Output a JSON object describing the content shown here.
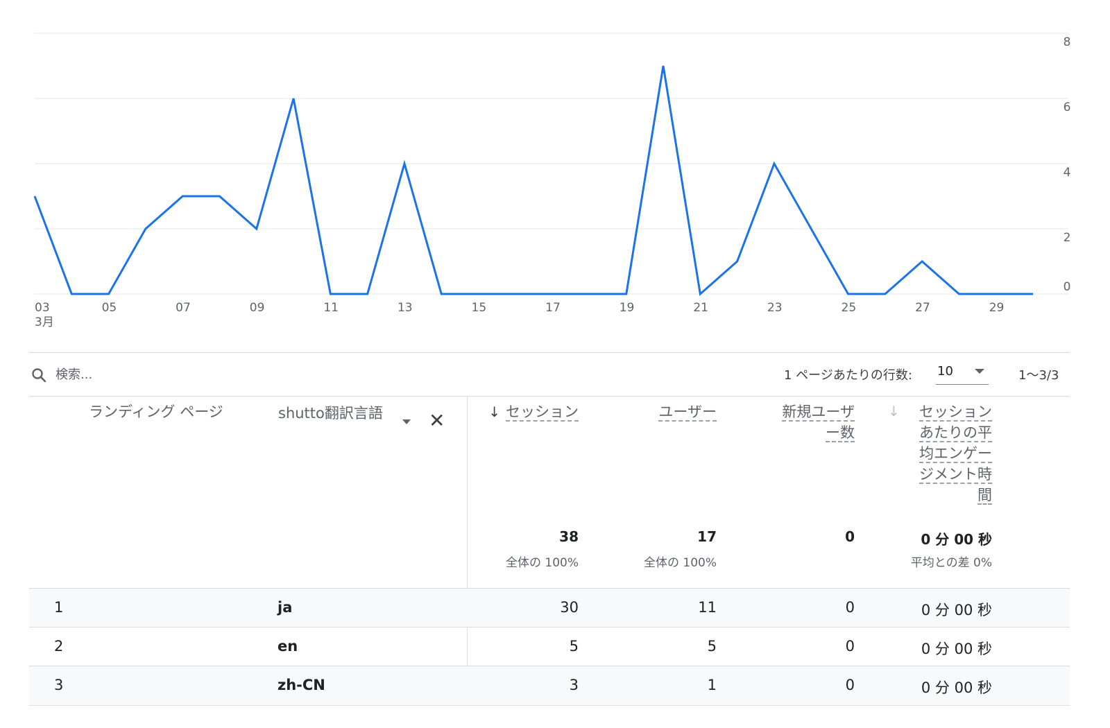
{
  "chart_data": {
    "type": "line",
    "title": "",
    "xlabel": "",
    "ylabel": "",
    "x": [
      3,
      4,
      5,
      6,
      7,
      8,
      9,
      10,
      11,
      12,
      13,
      14,
      15,
      16,
      17,
      18,
      19,
      20,
      21,
      22,
      23,
      24,
      25,
      26,
      27,
      28,
      29,
      30
    ],
    "series": [
      {
        "values": [
          3,
          0,
          0,
          2,
          3,
          3,
          2,
          6,
          0,
          0,
          4,
          0,
          0,
          0,
          0,
          0,
          0,
          7,
          0,
          1,
          4,
          2,
          0,
          0,
          1,
          0,
          0,
          0
        ]
      }
    ],
    "x_ticks": [
      "03",
      "05",
      "07",
      "09",
      "11",
      "13",
      "15",
      "17",
      "19",
      "21",
      "23",
      "25",
      "27",
      "29"
    ],
    "x_tick_values": [
      3,
      5,
      7,
      9,
      11,
      13,
      15,
      17,
      19,
      21,
      23,
      25,
      27,
      29
    ],
    "x_month_label": "3月",
    "y_ticks": [
      "0",
      "2",
      "4",
      "6",
      "8"
    ],
    "ylim": [
      0,
      8
    ],
    "color": "#1a73e8",
    "grid": true
  },
  "toolbar": {
    "search_placeholder": "検索...",
    "rows_per_page_label": "1 ページあたりの行数:",
    "rows_per_page_value": "10",
    "range": "1〜3/3"
  },
  "table": {
    "dim1_header": "ランディング ページ",
    "dim2_header": "shutto翻訳言語",
    "metric_headers": {
      "sessions": "セッション",
      "users": "ユーザー",
      "new_users_line1": "新規ユーザ",
      "new_users_line2": "ー数",
      "avg_engagement_lines": [
        "セッション",
        "あたりの平",
        "均エンゲー",
        "ジメント時",
        "間"
      ]
    },
    "sort_arrow": "↓",
    "totals": {
      "sessions": "38",
      "sessions_sub": "全体の 100%",
      "users": "17",
      "users_sub": "全体の 100%",
      "new_users": "0",
      "avg_engagement": "0 分 00 秒",
      "avg_engagement_sub": "平均との差 0%"
    },
    "rows": [
      {
        "index": "1",
        "language": "ja",
        "sessions": "30",
        "users": "11",
        "new_users": "0",
        "avg_engagement": "0 分 00 秒"
      },
      {
        "index": "2",
        "language": "en",
        "sessions": "5",
        "users": "5",
        "new_users": "0",
        "avg_engagement": "0 分 00 秒"
      },
      {
        "index": "3",
        "language": "zh-CN",
        "sessions": "3",
        "users": "1",
        "new_users": "0",
        "avg_engagement": "0 分 00 秒"
      }
    ]
  }
}
